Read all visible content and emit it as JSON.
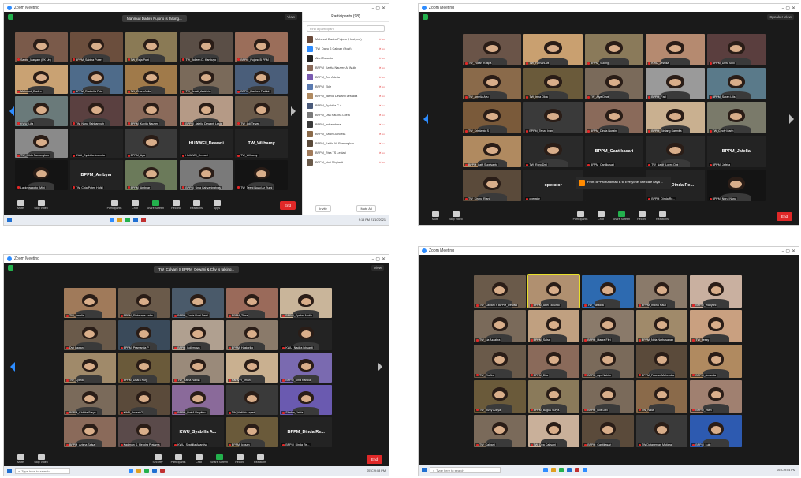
{
  "screenshots": [
    {
      "title": "Zoom Meeting",
      "talking_banner": "Mahmud Dadiro Pujono is talking...",
      "view_label": "View",
      "panel": {
        "title": "Participants (98)",
        "search_placeholder": "Find a participant",
        "rows": [
          "Mahmud Dadiro Pujono (Host, me)",
          "TW_Dayu S Caliyah (Host)",
          "Abel Tanunto",
          "BPPM_Kavita Nauven Al Wulir",
          "BPPM_Zee Adelia",
          "BPPM_Ekle",
          "BPPM_Jafelia Dewanti Lestada",
          "BPPM_Syabilla C.A",
          "BPPM_Dita Paulina Loela",
          "BPPM_Indrarahma",
          "BPPM_Kasih Dandelia",
          "BPPM_Kaitlin N. Pamungkas",
          "BPPM_Risa TS Lestari",
          "BPPM_Nuri Mirgianti"
        ],
        "invite": "Invite",
        "mute_all": "Mute All"
      },
      "tiles": [
        {
          "name": "Sabitu_Maryam (FK Un)",
          "cam": true,
          "c": "#7a5a4a"
        },
        {
          "name": "BPPM_Sabina Puteri",
          "cam": true,
          "c": "#6b4e3d"
        },
        {
          "name": "TW_Raja Putri",
          "cam": true,
          "c": "#8a7a55"
        },
        {
          "name": "TW_Jolleen D. Karstuyo",
          "cam": true,
          "c": "#5a4e46"
        },
        {
          "name": "BPPM_Pujono B PPM",
          "cam": true,
          "c": "#9b6e5a"
        },
        {
          "name": "Mahmud_Dadiro",
          "cam": true,
          "c": "#c9a273"
        },
        {
          "name": "BPPM_Rachelia Putri",
          "cam": true,
          "c": "#4e6b8a"
        },
        {
          "name": "TW_Zhara Aulia",
          "cam": true,
          "c": "#a07a4a"
        },
        {
          "name": "TW_Jessli_Andrieta",
          "cam": true,
          "c": "#7a6a5a"
        },
        {
          "name": "BPPM_Rashea Fadilah",
          "cam": true,
          "c": "#4a5e7a"
        },
        {
          "name": "KWU_Lifa",
          "cam": true,
          "c": "#6a7a7a"
        },
        {
          "name": "TW_Nurul Sahbaniyah",
          "cam": true,
          "c": "#5a4040"
        },
        {
          "name": "BPPM_Kavita Nauven",
          "cam": true,
          "c": "#8a6a5a"
        },
        {
          "name": "BPPM_Jafelia Dewanti Lesta",
          "cam": true,
          "c": "#b59a86"
        },
        {
          "name": "TW_Adi Tetyas",
          "cam": true,
          "c": "#6a5a4a"
        },
        {
          "name": "TW_Hilda Pamungkas",
          "cam": true,
          "c": "#8a8a8a"
        },
        {
          "name": "KWU_Syabilla Anandia",
          "cam": false,
          "c": "#232323"
        },
        {
          "name": "BPPM_Aya",
          "cam": true,
          "c": "#3a3a3a"
        },
        {
          "name": "HUAWEI_Dewani",
          "cam": false,
          "c": "#232323"
        },
        {
          "name": "TW_Wilhamy",
          "cam": false,
          "c": "#232323"
        },
        {
          "name": "Lacknowgotto_Mini",
          "cam": true,
          "c": "#141414"
        },
        {
          "name": "TW_Chia Puteri Hafid",
          "cam": false,
          "c": "#232323"
        },
        {
          "name": "BPPM_Ambyar",
          "cam": true,
          "c": "#6b7a5a"
        },
        {
          "name": "BPPM_Unia Cahyaningtyas",
          "cam": true,
          "c": "#7a7a7a"
        },
        {
          "name": "TW_Teeni Nuzul Ar Rumi",
          "cam": true,
          "c": "#141414"
        }
      ],
      "camoff_labels": {
        "18": "HUAWEI_Dewani",
        "19": "TW_Wilhamy",
        "21": "BPPM_Ambyar"
      },
      "toolbar": [
        "Mute",
        "Stop Video",
        "Participants",
        "Chat",
        "Share Screen",
        "Record",
        "Reactions",
        "Apps"
      ],
      "end": "End",
      "taskbar_time": "9:15 PM 21/10/2021"
    },
    {
      "title": "Zoom Meeting",
      "view_label": "Speaker View",
      "tiles": [
        {
          "name": "TW_Yuliani Kuspa",
          "cam": true,
          "c": "#6a5448"
        },
        {
          "name": "TW_FarhanDwi",
          "cam": true,
          "c": "#c9a070"
        },
        {
          "name": "BPPM_Sulung",
          "cam": true,
          "c": "#8a7a5a"
        },
        {
          "name": "KWU_Jessika",
          "cam": true,
          "c": "#b58a70"
        },
        {
          "name": "BPPM_Dewi Sulli",
          "cam": true,
          "c": "#5a3e3e"
        },
        {
          "name": "TW_Amelia Ayu",
          "cam": true,
          "c": "#8a6a4a"
        },
        {
          "name": "TW_Irma Okta",
          "cam": true,
          "c": "#6a5a3a"
        },
        {
          "name": "TW_Alya Dewi",
          "cam": true,
          "c": "#7a6a5a"
        },
        {
          "name": "BPPM_Fari",
          "cam": true,
          "c": "#9a9a9a"
        },
        {
          "name": "BPPM_Sarah Lilis",
          "cam": true,
          "c": "#5a7a8a"
        },
        {
          "name": "TW_Kristianto S",
          "cam": true,
          "c": "#7a5a3a"
        },
        {
          "name": "BPPM_Tenzo Ivan",
          "cam": true,
          "c": "#3a3a3a"
        },
        {
          "name": "BPPM_Dinda Nuraini",
          "cam": true,
          "c": "#8a6a5a"
        },
        {
          "name": "BPPM_Bintang Sasmita",
          "cam": true,
          "c": "#c9b090"
        },
        {
          "name": "TW_Cindy Marin",
          "cam": true,
          "c": "#7a7a6a"
        },
        {
          "name": "BPPM_Latif Supriyanto",
          "cam": true,
          "c": "#b08a60"
        },
        {
          "name": "TW_Roro Dwi",
          "cam": true,
          "c": "#2a2a2a"
        },
        {
          "name": "BPPM_Cantikasari",
          "cam": false,
          "c": "#232323"
        },
        {
          "name": "TW_Nadif_Loren Dwi",
          "cam": true,
          "c": "#2a2a2a"
        },
        {
          "name": "BPPM_Jafelia",
          "cam": false,
          "c": "#232323"
        },
        {
          "name": "TW_Kirana Riani",
          "cam": true,
          "c": "#5a4a3a"
        },
        {
          "name": "operator",
          "cam": false,
          "c": "#232323"
        },
        {
          "name": "",
          "cam": false,
          "c": "#1a1a1a"
        },
        {
          "name": "BPPM_Dinda Re...",
          "cam": false,
          "c": "#232323"
        },
        {
          "name": "BPPM_Nurul Nurul",
          "cam": true,
          "c": "#141414"
        }
      ],
      "camoff_labels": {
        "17": "BPPM_Cantikasari",
        "19": "BPPM_Jafelia",
        "21": "operator",
        "23": "BPPM_Dinda Re..."
      },
      "chat_popup": "From BPPM Kadiman B to Everyone: Mie cafe kaya ...",
      "toolbar": [
        "Mute",
        "Stop Video",
        "Participants",
        "Chat",
        "Share Screen",
        "Record",
        "Reactions"
      ],
      "end": "End"
    },
    {
      "title": "Zoom Meeting",
      "talking_banner": "TW_Calyani S BPPM_Dewani & Chy is talking...",
      "view_label": "View",
      "tiles": [
        {
          "name": "TW_Amelia",
          "cam": true,
          "c": "#a07a5a"
        },
        {
          "name": "BPPM_Sintasaya Ardin",
          "cam": true,
          "c": "#6a5a4a"
        },
        {
          "name": "BPPM_Zonia Putri Dewi",
          "cam": true,
          "c": "#4a5a6a"
        },
        {
          "name": "BPPM_Thea",
          "cam": true,
          "c": "#9a6a5a"
        },
        {
          "name": "BPPM_Syahra Mutia",
          "cam": true,
          "c": "#c9b59a"
        },
        {
          "name": "Dwi Irawan",
          "cam": true,
          "c": "#6a5a4a"
        },
        {
          "name": "BPPM_Pramanda P",
          "cam": true,
          "c": "#3a4a5a"
        },
        {
          "name": "BPPM_Lollymaya",
          "cam": true,
          "c": "#b0a090"
        },
        {
          "name": "BPPM_Hastoriko",
          "cam": true,
          "c": "#8a7a6a"
        },
        {
          "name": "KWU_Nadira Ikhsanti",
          "cam": true,
          "c": "#232323"
        },
        {
          "name": "TW_Kyana",
          "cam": true,
          "c": "#a08a6a"
        },
        {
          "name": "BPPM_Dhara Nurj",
          "cam": true,
          "c": "#6a5a3a"
        },
        {
          "name": "TW_Ratna Nabila",
          "cam": true,
          "c": "#9a8a7a"
        },
        {
          "name": "Hardy R_Ilman",
          "cam": true,
          "c": "#c9b090"
        },
        {
          "name": "BPPM_Dina Kamila",
          "cam": true,
          "c": "#7a6ab0"
        },
        {
          "name": "BPPM_Chikita Surya",
          "cam": true,
          "c": "#7a6a5a"
        },
        {
          "name": "KWU_Joveal G",
          "cam": true,
          "c": "#5a4a3a"
        },
        {
          "name": "BPPM_Dwi A Prayitno",
          "cam": true,
          "c": "#8a6a9a"
        },
        {
          "name": "TW_Nafilah Anjani",
          "cam": true,
          "c": "#3a3a3a"
        },
        {
          "name": "Shafira_Jalda",
          "cam": true,
          "c": "#6a5ab0"
        },
        {
          "name": "BPPM_Arisha Salsa",
          "cam": true,
          "c": "#8a6a5a"
        },
        {
          "name": "Kadiman S. Hendra Pratama",
          "cam": true,
          "c": "#5a4a4a"
        },
        {
          "name": "KWU_Syabilla Anandya",
          "cam": false,
          "c": "#232323"
        },
        {
          "name": "BPPM_Ichsan",
          "cam": true,
          "c": "#6a5a3a"
        },
        {
          "name": "BPPM_Dinda Re...",
          "cam": false,
          "c": "#232323"
        }
      ],
      "camoff_labels": {
        "22": "KWU_Syabilla A...",
        "24": "BPPM_Dinda Re..."
      },
      "toolbar": [
        "Mute",
        "Stop Video",
        "Security",
        "Participants",
        "Chat",
        "Share Screen",
        "Record",
        "Reactions"
      ],
      "end": "End",
      "taskbar_search": "Type here to search",
      "taskbar_time": "25°C 9:08 PM"
    },
    {
      "title": "Zoom Meeting",
      "tiles": [
        {
          "name": "TW_Calyani S BPPM_Dewani",
          "cam": true,
          "c": "#6a5a4a"
        },
        {
          "name": "BPPM_Abel Tanunto",
          "cam": true,
          "c": "#b09070"
        },
        {
          "name": "TW_Faradila",
          "cam": true,
          "c": "#2d6ab0"
        },
        {
          "name": "BPPM_Ihdina Nauli",
          "cam": true,
          "c": "#8a7a6a"
        },
        {
          "name": "BPPM_Wahyuni",
          "cam": true,
          "c": "#c9b0a0"
        },
        {
          "name": "TW_Lia Azzahra",
          "cam": true,
          "c": "#7a6a5a"
        },
        {
          "name": "BPPM_Salsa",
          "cam": true,
          "c": "#c0a080"
        },
        {
          "name": "BPPM_Maura Fitri",
          "cam": true,
          "c": "#8a7a6a"
        },
        {
          "name": "BPPM_Nela Nurhasanah",
          "cam": true,
          "c": "#a08a6a"
        },
        {
          "name": "TW_Jessy",
          "cam": true,
          "c": "#c9a080"
        },
        {
          "name": "TW_Zhafira",
          "cam": true,
          "c": "#6a5a4a"
        },
        {
          "name": "BPPM_Dita",
          "cam": true,
          "c": "#8a6a5a"
        },
        {
          "name": "BPPM_Ayu Nabila",
          "cam": true,
          "c": "#7a6a5a"
        },
        {
          "name": "BPPM_Fauzan Mahendra",
          "cam": true,
          "c": "#5a4a3a"
        },
        {
          "name": "BPPM_Amanda",
          "cam": true,
          "c": "#b08a60"
        },
        {
          "name": "TW_Rizky Aditya",
          "cam": true,
          "c": "#6a5a3a"
        },
        {
          "name": "BPPM_Bagus Surya",
          "cam": true,
          "c": "#8a7a5a"
        },
        {
          "name": "BPPM_Lilis Dwi",
          "cam": true,
          "c": "#7a6a5a"
        },
        {
          "name": "TW_Naila",
          "cam": true,
          "c": "#8a6a4a"
        },
        {
          "name": "BPPM_Intan",
          "cam": true,
          "c": "#a08070"
        },
        {
          "name": "TW_Calyani",
          "cam": true,
          "c": "#7a6a5a"
        },
        {
          "name": "TW_Dea Cahyani",
          "cam": true,
          "c": "#c9b09a"
        },
        {
          "name": "BPPM_Cantikasari",
          "cam": true,
          "c": "#5a4a3a"
        },
        {
          "name": "TW Dutaneryan Mutiara",
          "cam": true,
          "c": "#3a3a3a"
        },
        {
          "name": "BPPM_Lulu",
          "cam": true,
          "c": "#2d5ab0"
        }
      ],
      "taskbar_search": "Type here to search",
      "taskbar_time": "25°C 9:04 PM"
    }
  ]
}
